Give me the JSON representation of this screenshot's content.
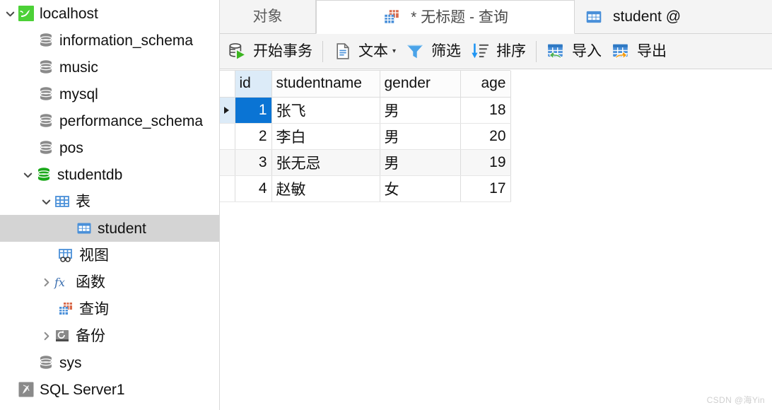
{
  "sidebar": {
    "items": [
      {
        "label": "localhost",
        "icon": "mysql-dolphin-icon",
        "indent": 0,
        "twisty": "down",
        "selected": false
      },
      {
        "label": "information_schema",
        "icon": "database-gray-icon",
        "indent": 1,
        "twisty": "none",
        "selected": false
      },
      {
        "label": "music",
        "icon": "database-gray-icon",
        "indent": 1,
        "twisty": "none",
        "selected": false
      },
      {
        "label": "mysql",
        "icon": "database-gray-icon",
        "indent": 1,
        "twisty": "none",
        "selected": false
      },
      {
        "label": "performance_schema",
        "icon": "database-gray-icon",
        "indent": 1,
        "twisty": "none",
        "selected": false
      },
      {
        "label": "pos",
        "icon": "database-gray-icon",
        "indent": 1,
        "twisty": "none",
        "selected": false
      },
      {
        "label": "studentdb",
        "icon": "database-green-icon",
        "indent": 1,
        "twisty": "down",
        "selected": false
      },
      {
        "label": "表",
        "icon": "table-folder-icon",
        "indent": 2,
        "twisty": "down",
        "selected": false
      },
      {
        "label": "student",
        "icon": "table-icon",
        "indent": 3,
        "twisty": "none",
        "selected": true
      },
      {
        "label": "视图",
        "icon": "view-icon",
        "indent": 2,
        "twisty": "none",
        "selected": false
      },
      {
        "label": "函数",
        "icon": "function-fx-icon",
        "indent": 2,
        "twisty": "right",
        "selected": false
      },
      {
        "label": "查询",
        "icon": "query-icon",
        "indent": 2,
        "twisty": "none",
        "selected": false
      },
      {
        "label": "备份",
        "icon": "backup-icon",
        "indent": 2,
        "twisty": "right",
        "selected": false
      },
      {
        "label": "sys",
        "icon": "database-gray-icon",
        "indent": 1,
        "twisty": "none",
        "selected": false
      },
      {
        "label": "SQL Server1",
        "icon": "sqlserver-icon",
        "indent": 0,
        "twisty": "none",
        "selected": false
      }
    ]
  },
  "tabs": [
    {
      "label": "对象",
      "icon": "none",
      "active": false
    },
    {
      "label": "* 无标题 - 查询",
      "icon": "query-icon",
      "active": true
    },
    {
      "label": "student @",
      "icon": "table-icon",
      "active": false
    }
  ],
  "toolbar": {
    "buttons": [
      {
        "label": "开始事务",
        "icon": "begin-transaction-icon",
        "caret": false
      },
      {
        "label": "文本",
        "icon": "text-doc-icon",
        "caret": true
      },
      {
        "label": "筛选",
        "icon": "filter-funnel-icon",
        "caret": false
      },
      {
        "label": "排序",
        "icon": "sort-descending-icon",
        "caret": false
      },
      {
        "label": "导入",
        "icon": "import-icon",
        "caret": false
      },
      {
        "label": "导出",
        "icon": "export-icon",
        "caret": false
      }
    ]
  },
  "grid": {
    "columns": [
      "id",
      "studentname",
      "gender",
      "age"
    ],
    "rows": [
      {
        "id": "1",
        "studentname": "张飞",
        "gender": "男",
        "age": "18"
      },
      {
        "id": "2",
        "studentname": "李白",
        "gender": "男",
        "age": "20"
      },
      {
        "id": "3",
        "studentname": "张无忌",
        "gender": "男",
        "age": "19"
      },
      {
        "id": "4",
        "studentname": "赵敏",
        "gender": "女",
        "age": "17"
      }
    ],
    "selected_cell": {
      "row": 0,
      "column": "id"
    }
  },
  "watermark": "CSDN @海Yin",
  "colors": {
    "selection_blue": "#0a74d4",
    "active_column_header": "#dcebf8",
    "sidebar_selection": "#d4d4d4",
    "chrome_gray": "#f4f4f4"
  }
}
